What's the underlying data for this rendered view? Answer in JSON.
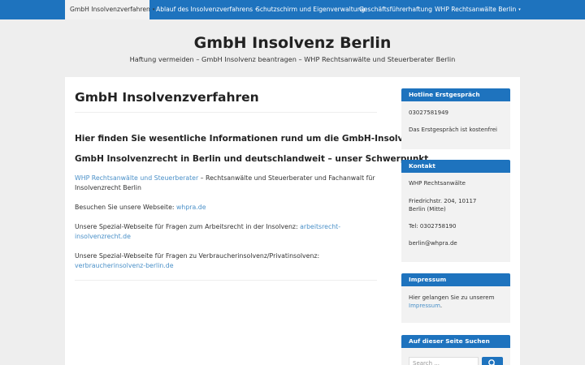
{
  "nav": {
    "items": [
      {
        "label": "GmbH Insolvenzverfahren",
        "caret": "▾"
      },
      {
        "label": "Ablauf des Insolvenzverfahrens",
        "caret": "▾"
      },
      {
        "label": "Schutzschirm und Eigenverwaltung",
        "caret": ""
      },
      {
        "label": "Geschäftsführerhaftung",
        "caret": ""
      },
      {
        "label": "WHP Rechtsanwälte Berlin",
        "caret": "▾"
      }
    ]
  },
  "site": {
    "title": "GmbH Insolvenz Berlin",
    "description": "Haftung vermeiden – GmbH Insolvenz beantragen – WHP Rechtsanwälte und Steuerberater Berlin"
  },
  "post": {
    "title": "GmbH Insolvenzverfahren",
    "heading1": "Hier finden Sie wesentliche Informationen rund um die GmbH-Insolvenz",
    "heading2": "GmbH Insolvenzrecht in Berlin und deutschlandweit – unser Schwerpunkt.",
    "p1_link": "WHP Rechtsanwälte und Steuerberater",
    "p1_rest": " – Rechtsanwälte und Steuerberater und Fachanwalt für Insolvenzrecht Berlin",
    "p2_text": "Besuchen Sie unsere Webseite: ",
    "p2_link": "whpra.de",
    "p3_text": "Unsere Spezial-Webseite für Fragen zum Arbeitsrecht in der Insolvenz: ",
    "p3_link": "arbeitsrecht-insolvenzrecht.de",
    "p4_text": "Unsere Spezial-Webseite für Fragen zu Verbraucherinsolvenz/Privatinsolvenz: ",
    "p4_link": "verbraucherinsolvenz-berlin.de"
  },
  "sidebar": {
    "hotline": {
      "title": "Hotline Erstgespräch",
      "phone": "03027581949",
      "note": "Das Erstgespräch ist kostenfrei"
    },
    "kontakt": {
      "title": "Kontakt",
      "name": "WHP Rechtsanwälte",
      "address": "Friedrichstr. 204, 10117 Berlin (Mitte)",
      "tel": "Tel: 0302758190",
      "email": "berlin@whpra.de"
    },
    "impressum": {
      "title": "Impressum",
      "text": "Hier gelangen Sie zu unserem ",
      "link": "Impressum",
      "dot": "."
    },
    "search": {
      "title": "Auf dieser Seite Suchen",
      "placeholder": "Search ..."
    }
  }
}
